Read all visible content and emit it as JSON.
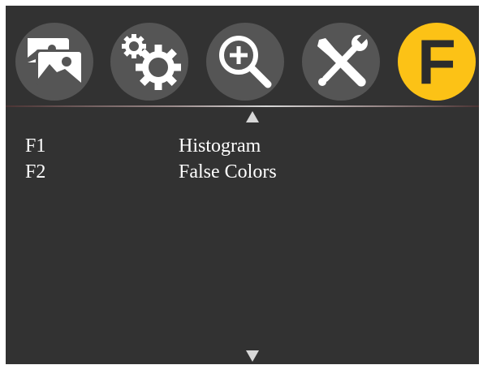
{
  "tabs": [
    {
      "icon": "images-icon",
      "label": ""
    },
    {
      "icon": "gears-icon",
      "label": ""
    },
    {
      "icon": "zoom-in-icon",
      "label": ""
    },
    {
      "icon": "tools-icon",
      "label": ""
    },
    {
      "icon": "function-f-icon",
      "label": "F",
      "active": true
    }
  ],
  "function_list": [
    {
      "key": "F1",
      "label": "Histogram"
    },
    {
      "key": "F2",
      "label": "False Colors"
    }
  ],
  "colors": {
    "background": "#323232",
    "tab_inactive": "#555555",
    "tab_active": "#fcc216",
    "icon": "#ffffff",
    "text": "#ffffff"
  }
}
